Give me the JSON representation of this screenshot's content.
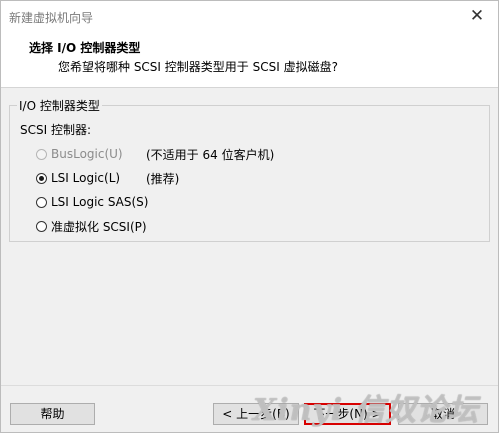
{
  "window": {
    "title": "新建虚拟机向导",
    "close_glyph": "✕"
  },
  "header": {
    "title": "选择 I/O 控制器类型",
    "subtitle": "您希望将哪种 SCSI 控制器类型用于 SCSI 虚拟磁盘?"
  },
  "group": {
    "legend": "I/O 控制器类型",
    "controller_label": "SCSI 控制器:",
    "options": [
      {
        "label": "BusLogic(U)",
        "note": "(不适用于 64 位客户机)",
        "checked": false,
        "disabled": true
      },
      {
        "label": "LSI Logic(L)",
        "note": "(推荐)",
        "checked": true,
        "disabled": false
      },
      {
        "label": "LSI Logic SAS(S)",
        "note": "",
        "checked": false,
        "disabled": false
      },
      {
        "label": "准虚拟化 SCSI(P)",
        "note": "",
        "checked": false,
        "disabled": false
      }
    ]
  },
  "buttons": {
    "help": "帮助",
    "back": "< 上一步(B)",
    "next": "下一步(N) >",
    "cancel": "取消"
  },
  "watermark": "Xinyi 信奴论坛"
}
